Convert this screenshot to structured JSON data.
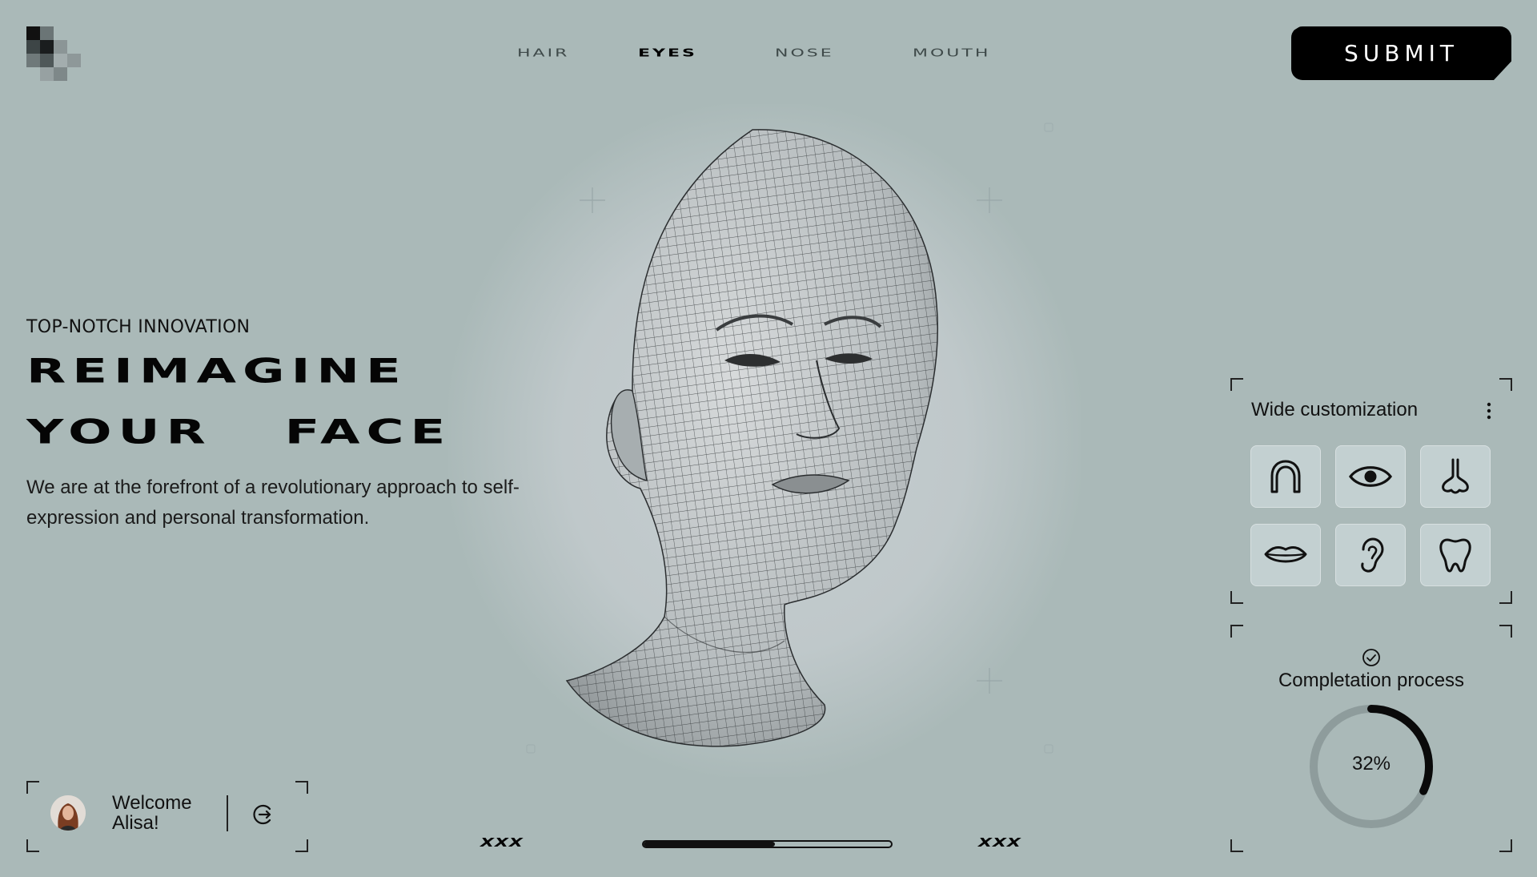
{
  "logo": {
    "icon": "pixel-mosaic-logo"
  },
  "nav": {
    "items": [
      {
        "label": "HAIR",
        "active": false
      },
      {
        "label": "EYES",
        "active": true
      },
      {
        "label": "NOSE",
        "active": false
      },
      {
        "label": "MOUTH",
        "active": false
      }
    ]
  },
  "header": {
    "submit_label": "SUBMIT"
  },
  "hero": {
    "tagline": "TOP-NOTCH INNOVATION",
    "title_line1": "REIMAGINE",
    "title_line2": "YOUR   FACE",
    "description": "We are at the forefront of a revolutionary approach to self-expression and personal transformation."
  },
  "customization": {
    "title": "Wide customization",
    "features": [
      {
        "name": "hair",
        "icon": "hair-icon"
      },
      {
        "name": "eye",
        "icon": "eye-icon"
      },
      {
        "name": "nose",
        "icon": "nose-icon"
      },
      {
        "name": "lips",
        "icon": "lips-icon"
      },
      {
        "name": "ear",
        "icon": "ear-icon"
      },
      {
        "name": "tooth",
        "icon": "tooth-icon"
      }
    ]
  },
  "progress": {
    "title": "Completation process",
    "value": 32,
    "label": "32%"
  },
  "user": {
    "greeting": "Welcome",
    "name": "Alisa!"
  },
  "slider": {
    "left_label": "XXX",
    "right_label": "XXX",
    "fill_fraction": 0.53
  },
  "colors": {
    "background": "#aab9b8",
    "accent": "#000000",
    "ring_track": "#8e9c9c",
    "tile": "#c3d0d1"
  }
}
